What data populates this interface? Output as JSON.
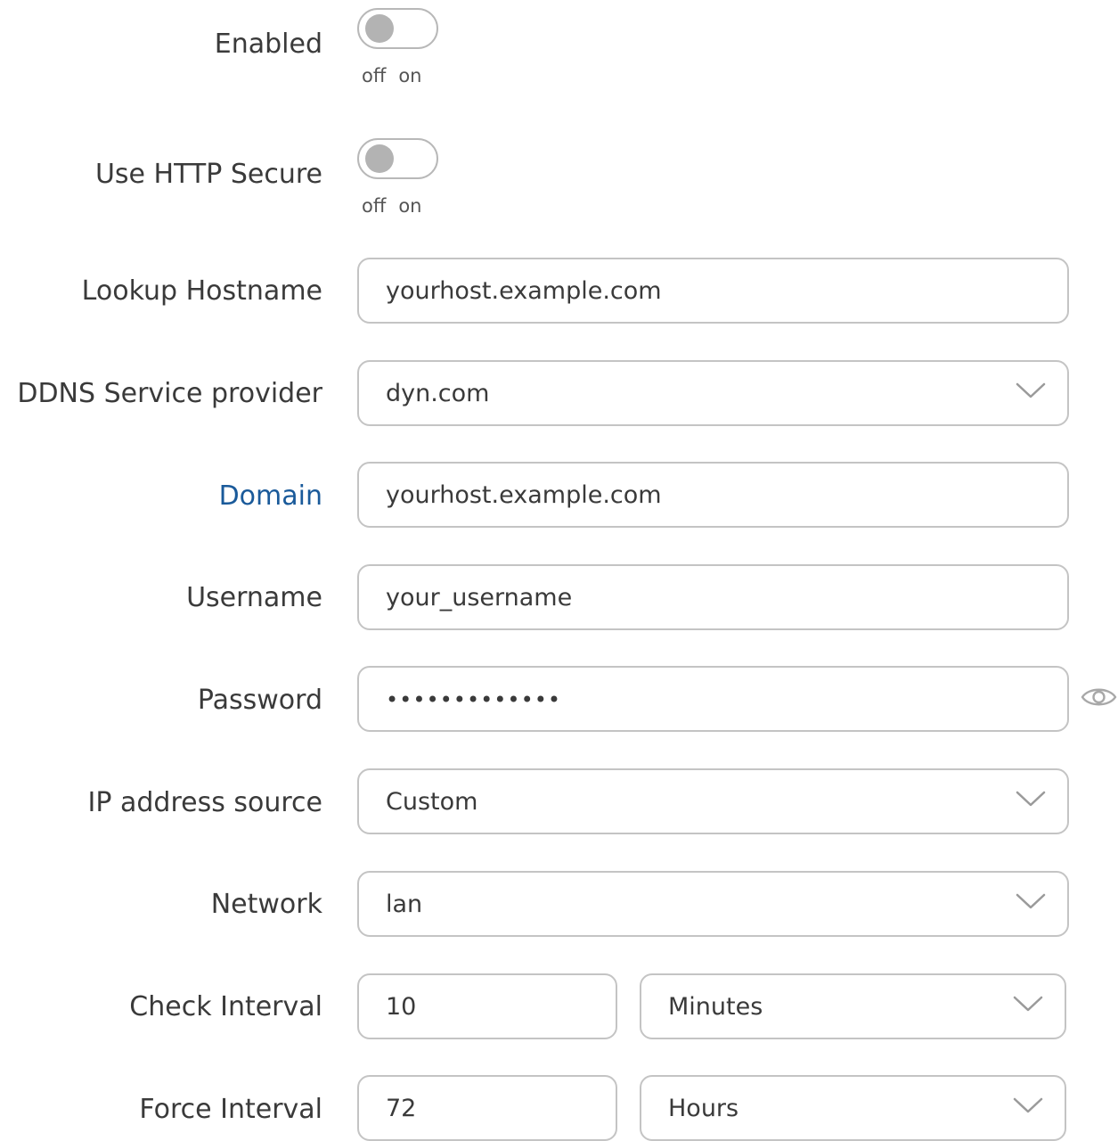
{
  "enabled": {
    "label": "Enabled",
    "off_label": "off",
    "on_label": "on",
    "state": "off"
  },
  "https": {
    "label": "Use HTTP Secure",
    "off_label": "off",
    "on_label": "on",
    "state": "off"
  },
  "lookup_hostname": {
    "label": "Lookup Hostname",
    "value": "yourhost.example.com"
  },
  "service_provider": {
    "label": "DDNS Service provider",
    "value": "dyn.com"
  },
  "domain": {
    "label": "Domain",
    "value": "yourhost.example.com"
  },
  "username": {
    "label": "Username",
    "value": "your_username"
  },
  "password": {
    "label": "Password",
    "value": "•••••••••••••"
  },
  "ip_source": {
    "label": "IP address source",
    "value": "Custom"
  },
  "network": {
    "label": "Network",
    "value": "lan"
  },
  "check_interval": {
    "label": "Check Interval",
    "value": "10",
    "unit": "Minutes"
  },
  "force_interval": {
    "label": "Force Interval",
    "value": "72",
    "unit": "Hours"
  },
  "icons": {
    "select_arrow": "chevron-down-icon",
    "reveal_password": "eye-icon"
  }
}
